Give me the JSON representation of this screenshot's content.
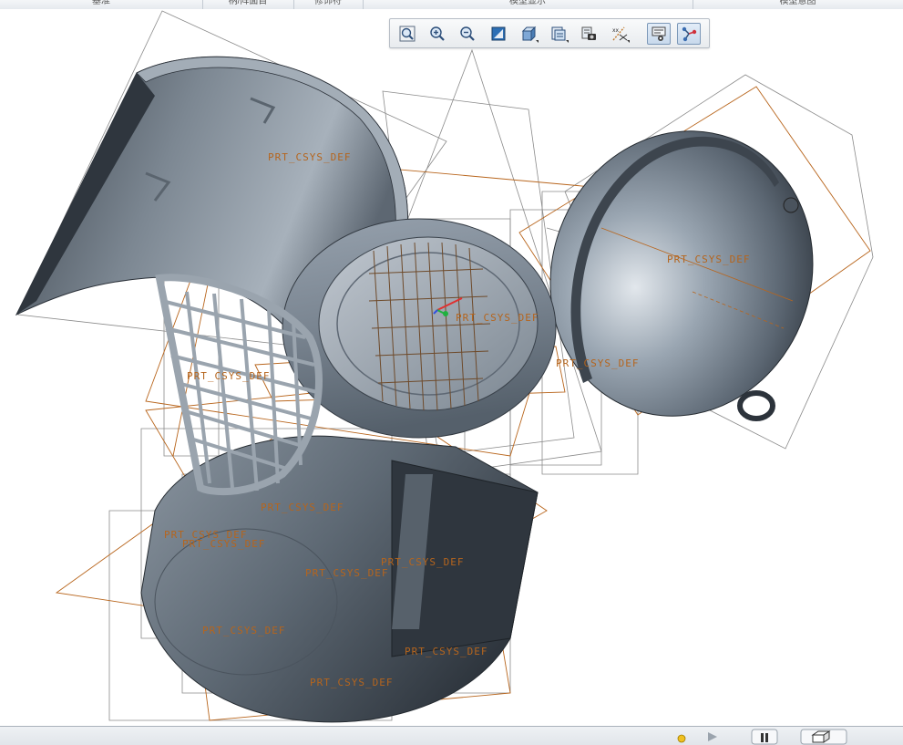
{
  "ribbon": {
    "groups": [
      {
        "label": "基准"
      },
      {
        "label": "柄/阵面目"
      },
      {
        "label": "修饰符"
      },
      {
        "label": "模型显示"
      },
      {
        "label": "模型意图"
      }
    ]
  },
  "view_toolbar": {
    "buttons": [
      {
        "name": "refit",
        "icon": "zoom-fit-icon"
      },
      {
        "name": "zoom-in",
        "icon": "zoom-in-icon"
      },
      {
        "name": "zoom-out",
        "icon": "zoom-out-icon"
      },
      {
        "name": "repaint",
        "icon": "repaint-icon"
      },
      {
        "name": "display-style",
        "icon": "display-style-icon"
      },
      {
        "name": "saved-orientations",
        "icon": "saved-orientations-icon"
      },
      {
        "name": "view-manager",
        "icon": "view-manager-icon"
      },
      {
        "name": "datum-display",
        "icon": "datum-display-icon"
      },
      {
        "name": "annotation-display",
        "icon": "annotation-display-icon",
        "active": true
      },
      {
        "name": "spin-center",
        "icon": "spin-center-icon",
        "active": true
      }
    ]
  },
  "model": {
    "csys_labels": [
      "PRT_CSYS_DEF",
      "PRT_CSYS_DEF",
      "PRT_CSYS_DEF",
      "PRT_CSYS_DEF",
      "PRT_CSYS_DEF",
      "PRT_CSYS_DEF",
      "PRT_CSYS_DEF",
      "PRT_CSYS_DEF",
      "PRT_CSYS_DEF",
      "PRT_CSYS_DEF",
      "PRT_CSYS_DEF",
      "PRT_CSYS_DEF",
      "PRT_CSYS_DEF"
    ],
    "colors": {
      "shell": "#6b7785",
      "shell_light": "#c9d0d8",
      "shell_dark": "#2c333b",
      "datum_plane": "#b8651c",
      "wire": "#8a8a8a",
      "csys_x": "#e03030",
      "csys_y": "#20b040",
      "csys_z": "#3050e0"
    }
  },
  "status_bar": {
    "icons": [
      "status-light-icon",
      "flag-icon",
      "pause-icon",
      "selection-filter-icon"
    ]
  }
}
